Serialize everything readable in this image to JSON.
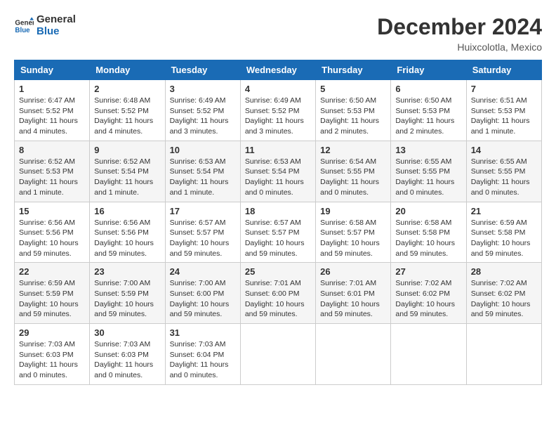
{
  "logo": {
    "line1": "General",
    "line2": "Blue"
  },
  "title": "December 2024",
  "location": "Huixcolotla, Mexico",
  "days_header": [
    "Sunday",
    "Monday",
    "Tuesday",
    "Wednesday",
    "Thursday",
    "Friday",
    "Saturday"
  ],
  "weeks": [
    [
      {
        "day": "1",
        "info": "Sunrise: 6:47 AM\nSunset: 5:52 PM\nDaylight: 11 hours\nand 4 minutes."
      },
      {
        "day": "2",
        "info": "Sunrise: 6:48 AM\nSunset: 5:52 PM\nDaylight: 11 hours\nand 4 minutes."
      },
      {
        "day": "3",
        "info": "Sunrise: 6:49 AM\nSunset: 5:52 PM\nDaylight: 11 hours\nand 3 minutes."
      },
      {
        "day": "4",
        "info": "Sunrise: 6:49 AM\nSunset: 5:52 PM\nDaylight: 11 hours\nand 3 minutes."
      },
      {
        "day": "5",
        "info": "Sunrise: 6:50 AM\nSunset: 5:53 PM\nDaylight: 11 hours\nand 2 minutes."
      },
      {
        "day": "6",
        "info": "Sunrise: 6:50 AM\nSunset: 5:53 PM\nDaylight: 11 hours\nand 2 minutes."
      },
      {
        "day": "7",
        "info": "Sunrise: 6:51 AM\nSunset: 5:53 PM\nDaylight: 11 hours\nand 1 minute."
      }
    ],
    [
      {
        "day": "8",
        "info": "Sunrise: 6:52 AM\nSunset: 5:53 PM\nDaylight: 11 hours\nand 1 minute."
      },
      {
        "day": "9",
        "info": "Sunrise: 6:52 AM\nSunset: 5:54 PM\nDaylight: 11 hours\nand 1 minute."
      },
      {
        "day": "10",
        "info": "Sunrise: 6:53 AM\nSunset: 5:54 PM\nDaylight: 11 hours\nand 1 minute."
      },
      {
        "day": "11",
        "info": "Sunrise: 6:53 AM\nSunset: 5:54 PM\nDaylight: 11 hours\nand 0 minutes."
      },
      {
        "day": "12",
        "info": "Sunrise: 6:54 AM\nSunset: 5:55 PM\nDaylight: 11 hours\nand 0 minutes."
      },
      {
        "day": "13",
        "info": "Sunrise: 6:55 AM\nSunset: 5:55 PM\nDaylight: 11 hours\nand 0 minutes."
      },
      {
        "day": "14",
        "info": "Sunrise: 6:55 AM\nSunset: 5:55 PM\nDaylight: 11 hours\nand 0 minutes."
      }
    ],
    [
      {
        "day": "15",
        "info": "Sunrise: 6:56 AM\nSunset: 5:56 PM\nDaylight: 10 hours\nand 59 minutes."
      },
      {
        "day": "16",
        "info": "Sunrise: 6:56 AM\nSunset: 5:56 PM\nDaylight: 10 hours\nand 59 minutes."
      },
      {
        "day": "17",
        "info": "Sunrise: 6:57 AM\nSunset: 5:57 PM\nDaylight: 10 hours\nand 59 minutes."
      },
      {
        "day": "18",
        "info": "Sunrise: 6:57 AM\nSunset: 5:57 PM\nDaylight: 10 hours\nand 59 minutes."
      },
      {
        "day": "19",
        "info": "Sunrise: 6:58 AM\nSunset: 5:57 PM\nDaylight: 10 hours\nand 59 minutes."
      },
      {
        "day": "20",
        "info": "Sunrise: 6:58 AM\nSunset: 5:58 PM\nDaylight: 10 hours\nand 59 minutes."
      },
      {
        "day": "21",
        "info": "Sunrise: 6:59 AM\nSunset: 5:58 PM\nDaylight: 10 hours\nand 59 minutes."
      }
    ],
    [
      {
        "day": "22",
        "info": "Sunrise: 6:59 AM\nSunset: 5:59 PM\nDaylight: 10 hours\nand 59 minutes."
      },
      {
        "day": "23",
        "info": "Sunrise: 7:00 AM\nSunset: 5:59 PM\nDaylight: 10 hours\nand 59 minutes."
      },
      {
        "day": "24",
        "info": "Sunrise: 7:00 AM\nSunset: 6:00 PM\nDaylight: 10 hours\nand 59 minutes."
      },
      {
        "day": "25",
        "info": "Sunrise: 7:01 AM\nSunset: 6:00 PM\nDaylight: 10 hours\nand 59 minutes."
      },
      {
        "day": "26",
        "info": "Sunrise: 7:01 AM\nSunset: 6:01 PM\nDaylight: 10 hours\nand 59 minutes."
      },
      {
        "day": "27",
        "info": "Sunrise: 7:02 AM\nSunset: 6:02 PM\nDaylight: 10 hours\nand 59 minutes."
      },
      {
        "day": "28",
        "info": "Sunrise: 7:02 AM\nSunset: 6:02 PM\nDaylight: 10 hours\nand 59 minutes."
      }
    ],
    [
      {
        "day": "29",
        "info": "Sunrise: 7:03 AM\nSunset: 6:03 PM\nDaylight: 11 hours\nand 0 minutes."
      },
      {
        "day": "30",
        "info": "Sunrise: 7:03 AM\nSunset: 6:03 PM\nDaylight: 11 hours\nand 0 minutes."
      },
      {
        "day": "31",
        "info": "Sunrise: 7:03 AM\nSunset: 6:04 PM\nDaylight: 11 hours\nand 0 minutes."
      },
      null,
      null,
      null,
      null
    ]
  ]
}
